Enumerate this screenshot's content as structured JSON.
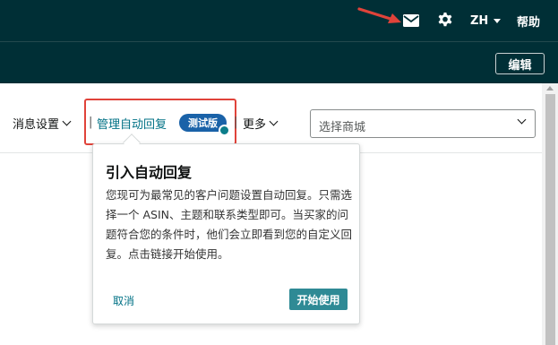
{
  "header": {
    "language": "ZH",
    "help": "帮助",
    "icons": [
      "mail-icon",
      "gear-icon"
    ],
    "edit_label": "编辑"
  },
  "nav": {
    "message_settings": "消息设置",
    "separator": "|",
    "auto_reply": "管理自动回复",
    "beta_badge": "测试版",
    "more": "更多",
    "store_placeholder": "选择商城"
  },
  "popover": {
    "title": "引入自动回复",
    "body": "您现可为最常见的客户问题设置自动回复。只需选择一个 ASIN、主题和联系类型即可。当买家的问题符合您的条件时，他们会立即看到您的自定义回复。点击链接开始使用。",
    "cancel": "取消",
    "start": "开始使用"
  },
  "colors": {
    "header_bg": "#002f36",
    "link": "#007185",
    "beta_badge": "#1a62a8",
    "highlight": "#e0433a",
    "annotation_arrow": "#e0433a",
    "primary_button": "#2f8a95"
  }
}
